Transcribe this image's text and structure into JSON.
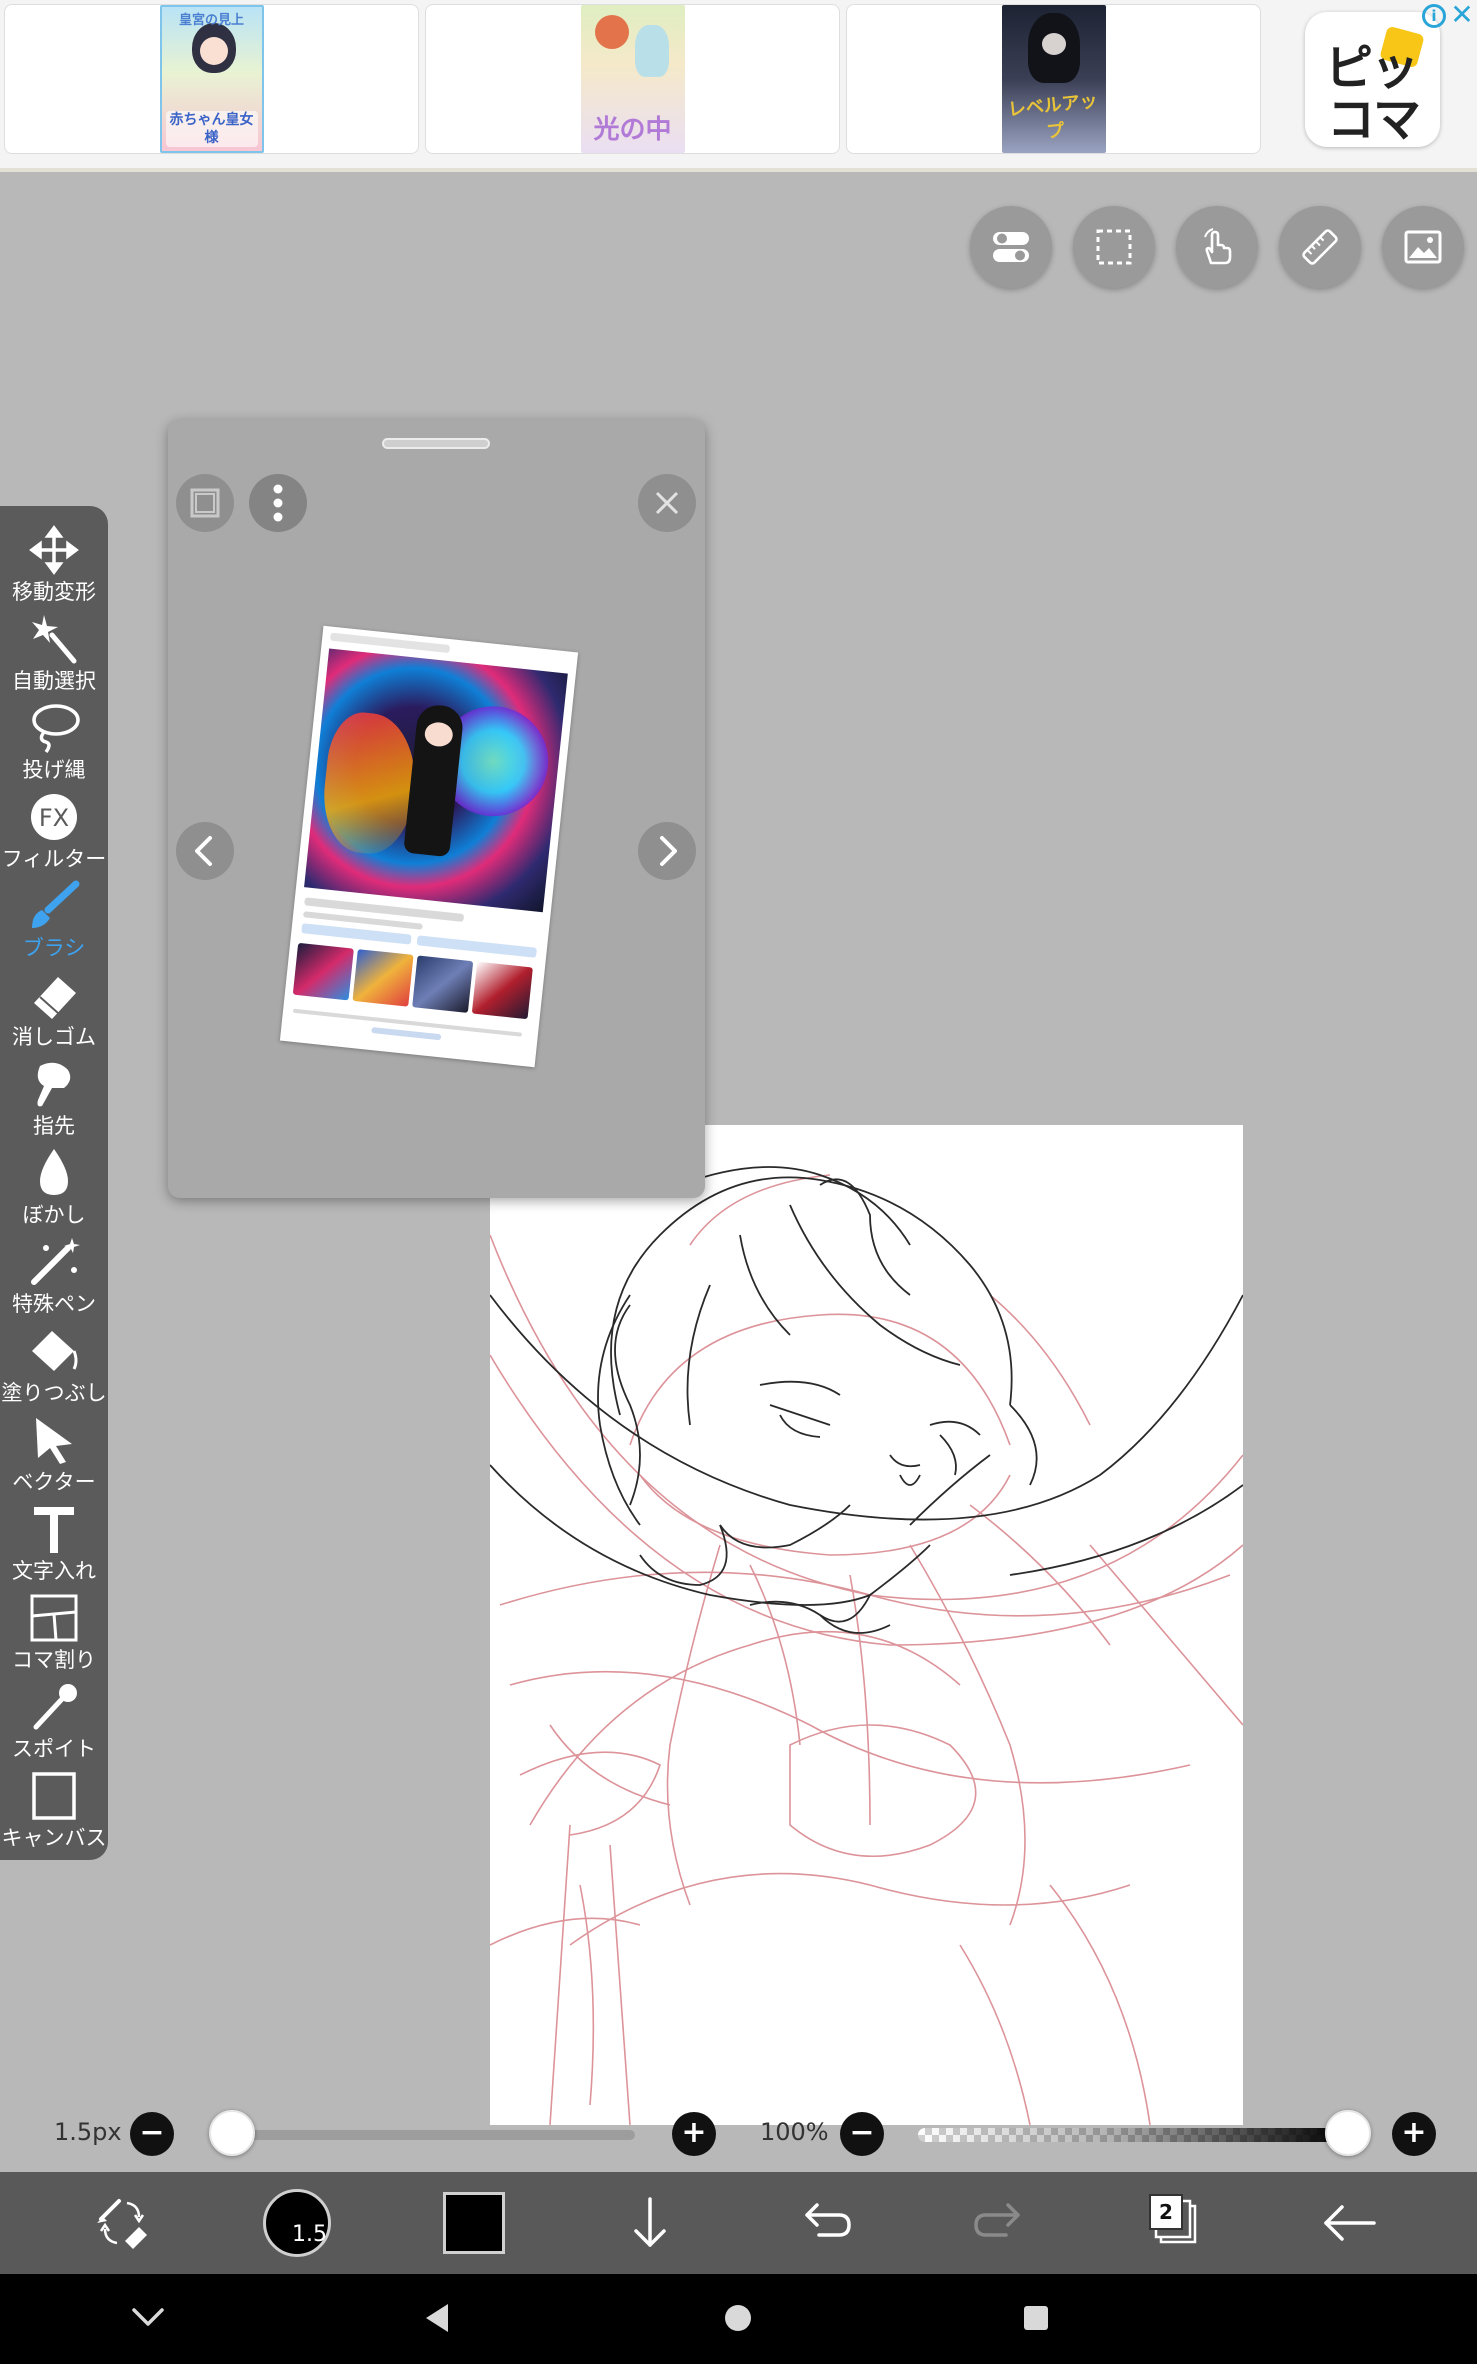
{
  "ad": {
    "covers": [
      {
        "title_top": "皇宮の見上",
        "title_bottom": "赤ちゃん皇女様"
      },
      {
        "title": "光の中"
      },
      {
        "title": "レベルアップ"
      }
    ],
    "logo_line1": "ピッ",
    "logo_line2": "コマ",
    "info_label": "i",
    "close_label": "✕"
  },
  "top_tools": [
    {
      "icon": "toggle-switches-icon"
    },
    {
      "icon": "selection-marquee-icon"
    },
    {
      "icon": "hand-gesture-icon"
    },
    {
      "icon": "ruler-icon"
    },
    {
      "icon": "image-reference-icon"
    }
  ],
  "left_toolbar": {
    "tools": [
      {
        "label": "移動変形",
        "icon": "move-transform-icon"
      },
      {
        "label": "自動選択",
        "icon": "magic-wand-icon"
      },
      {
        "label": "投げ縄",
        "icon": "lasso-icon"
      },
      {
        "label": "フィルター",
        "icon": "fx-filter-icon"
      },
      {
        "label": "ブラシ",
        "icon": "brush-icon",
        "active": true
      },
      {
        "label": "消しゴム",
        "icon": "eraser-icon"
      },
      {
        "label": "指先",
        "icon": "finger-smudge-icon"
      },
      {
        "label": "ぼかし",
        "icon": "blur-drop-icon"
      },
      {
        "label": "特殊ペン",
        "icon": "special-pen-icon"
      },
      {
        "label": "塗りつぶし",
        "icon": "fill-bucket-icon"
      },
      {
        "label": "ベクター",
        "icon": "vector-arrow-icon"
      },
      {
        "label": "文字入れ",
        "icon": "text-icon"
      },
      {
        "label": "コマ割り",
        "icon": "panel-layout-icon"
      },
      {
        "label": "スポイト",
        "icon": "eyedropper-icon"
      },
      {
        "label": "キャンバス",
        "icon": "canvas-icon"
      }
    ],
    "active_color": "#3ea2ee"
  },
  "reference_panel": {
    "icons": [
      "window-icon",
      "more-vertical-icon",
      "close-icon",
      "chevron-left-icon",
      "chevron-right-icon"
    ]
  },
  "controls": {
    "brush_size_label": "1.5px",
    "brush_size_fraction": 0.0,
    "opacity_label": "100%",
    "opacity_fraction": 1.0,
    "minus": "−",
    "plus": "+"
  },
  "bottom_bar": {
    "brush_size_value": "1.5",
    "primary_color": "#000000",
    "layer_count": "2"
  },
  "colors": {
    "workspace_bg": "#b8b8b8",
    "toolbar_bg": "#5b5b5b",
    "bottom_bar_bg": "#595959",
    "sketch_black": "#2a2a2a",
    "sketch_red": "#d9888f"
  }
}
